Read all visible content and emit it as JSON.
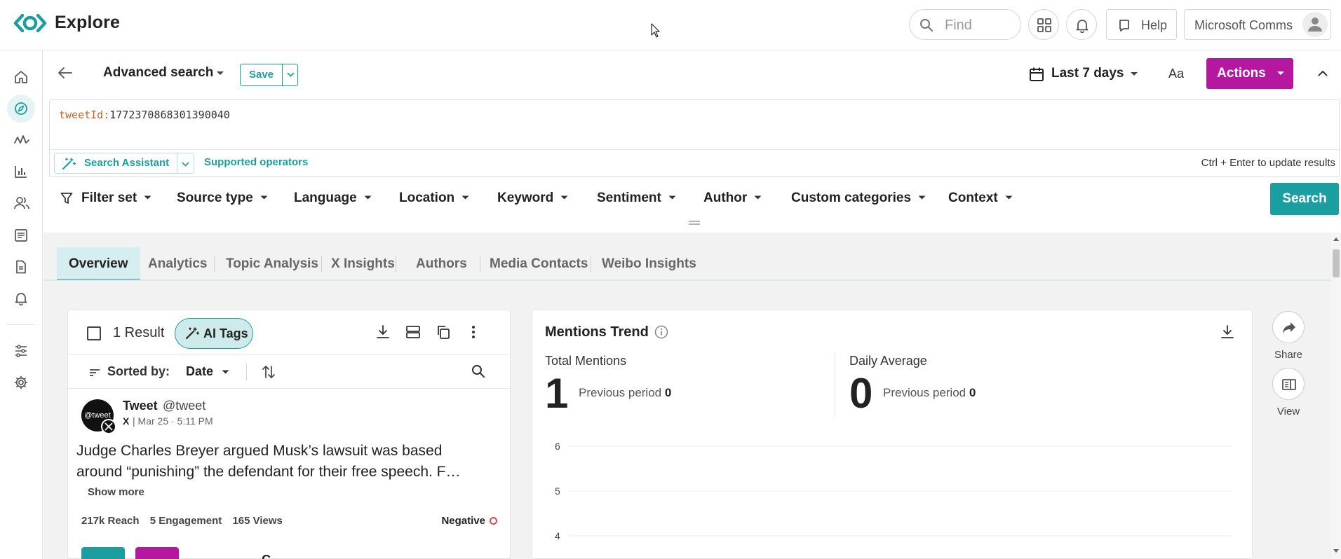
{
  "header": {
    "title": "Explore",
    "find_placeholder": "Find",
    "help_label": "Help",
    "account_label": "Microsoft Comms"
  },
  "search_bar": {
    "search_name": "Advanced search",
    "save_label": "Save",
    "date_range": "Last 7 days",
    "font_toggle": "Aa",
    "actions_label": "Actions"
  },
  "query": {
    "field": "tweetId:",
    "value": "1772370868301390040",
    "assistant_label": "Search Assistant",
    "operators_label": "Supported operators",
    "shortcut_hint": "Ctrl + Enter to update results"
  },
  "filters": [
    "Filter set",
    "Source type",
    "Language",
    "Location",
    "Keyword",
    "Sentiment",
    "Author",
    "Custom categories",
    "Context"
  ],
  "search_button": "Search",
  "tabs": [
    "Overview",
    "Analytics",
    "Topic Analysis",
    "X Insights",
    "Authors",
    "Media Contacts",
    "Weibo Insights"
  ],
  "results": {
    "count_label": "1 Result",
    "ai_tags_label": "AI Tags",
    "sorted_by_label": "Sorted by:",
    "sort_value": "Date"
  },
  "post": {
    "avatar_text": "@tweet",
    "name": "Tweet",
    "handle": "@tweet",
    "source": "X",
    "meta": "| Mar 25 · 5:11 PM",
    "body_line1": "Judge Charles Breyer argued Musk’s lawsuit was based",
    "body_line2": "around “punishing” the defendant for their free speech. F…",
    "show_more": "Show more",
    "reach": "217k Reach",
    "engagement": "5 Engagement",
    "views": "165 Views",
    "sentiment": "Negative",
    "extra": "C"
  },
  "trend": {
    "title": "Mentions Trend",
    "total_label": "Total Mentions",
    "total_value": "1",
    "total_prev_label": "Previous period",
    "total_prev_value": "0",
    "daily_label": "Daily Average",
    "daily_value": "0",
    "daily_prev_label": "Previous period",
    "daily_prev_value": "0",
    "y_ticks": [
      "6",
      "5",
      "4"
    ]
  },
  "side_actions": {
    "share_label": "Share",
    "view_label": "View"
  },
  "colors": {
    "accent": "#1a9ea0",
    "actions": "#b5179e",
    "negative": "#e24a4a"
  }
}
